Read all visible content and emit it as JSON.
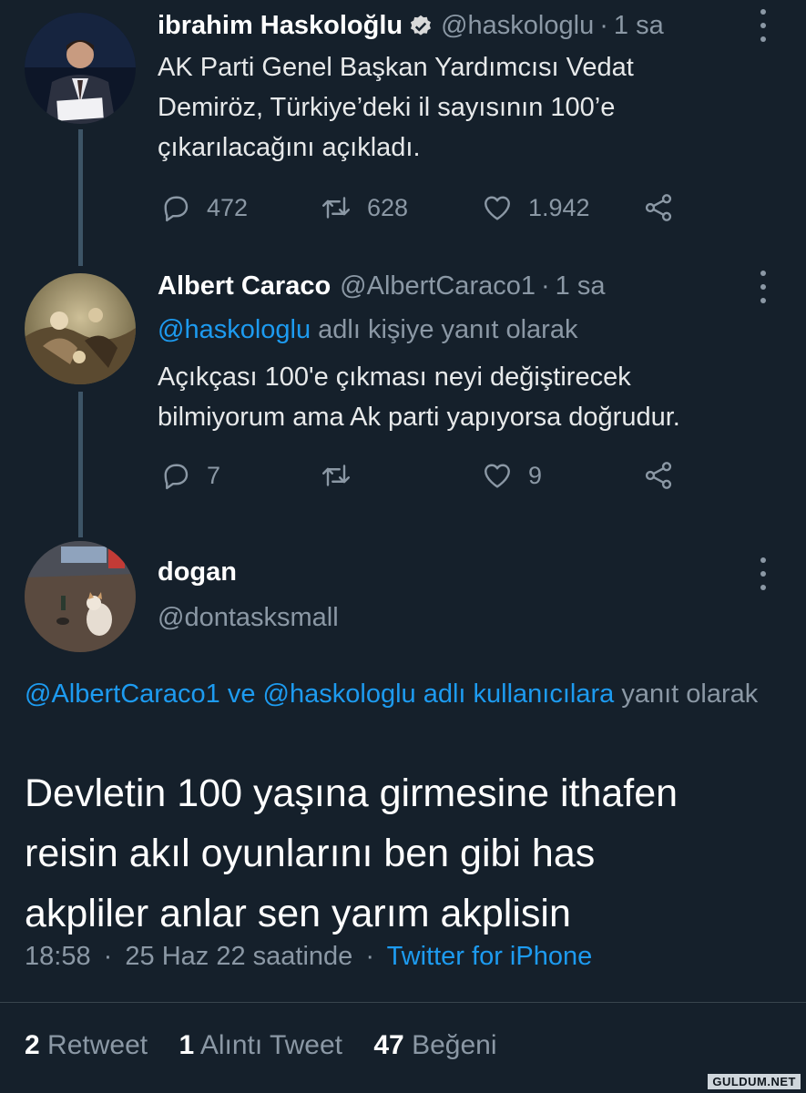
{
  "tweets": [
    {
      "name": "ibrahim Haskoloğlu",
      "handle": "@haskologlu",
      "time": "1 sa",
      "verified": true,
      "text_lines": [
        "AK Parti Genel Başkan Yardımcısı Vedat",
        "Demiröz, Türkiye’deki il sayısının 100’e",
        "çıkarılacağını açıkladı."
      ],
      "replies": "472",
      "retweets": "628",
      "likes": "1.942"
    },
    {
      "name": "Albert Caraco",
      "handle": "@AlbertCaraco1",
      "time": "1 sa",
      "reply_to_handle": "@haskologlu",
      "reply_to_suffix": "adlı kişiye yanıt olarak",
      "text_lines": [
        "Açıkçası 100'e çıkması neyi değiştirecek",
        "bilmiyorum ama Ak parti yapıyorsa doğrudur."
      ],
      "replies": "7",
      "retweets": "",
      "likes": "9"
    }
  ],
  "main_tweet": {
    "name": "dogan",
    "handle": "@dontasksmall",
    "replying_links": "@AlbertCaraco1 ve @haskologlu adlı kullanıcılara",
    "replying_suffix": " yanıt olarak",
    "text_lines": [
      "Devletin 100 yaşına girmesine ithafen",
      "reisin akıl oyunlarını ben gibi has",
      "akpliler anlar sen yarım akplisin"
    ],
    "time": "18:58",
    "date": "25 Haz 22 saatinde",
    "source": "Twitter for iPhone",
    "stats": {
      "retweets_count": "2",
      "retweets_label": "Retweet",
      "quotes_count": "1",
      "quotes_label": "Alıntı Tweet",
      "likes_count": "47",
      "likes_label": "Beğeni"
    }
  },
  "separator": "·",
  "watermark": "GULDUM.NET",
  "colors": {
    "background": "#15202b",
    "link": "#1d9bf0",
    "muted": "#8b98a5"
  },
  "icons": [
    "verified-badge-icon",
    "reply-icon",
    "retweet-icon",
    "like-icon",
    "share-icon",
    "more-options-icon"
  ]
}
